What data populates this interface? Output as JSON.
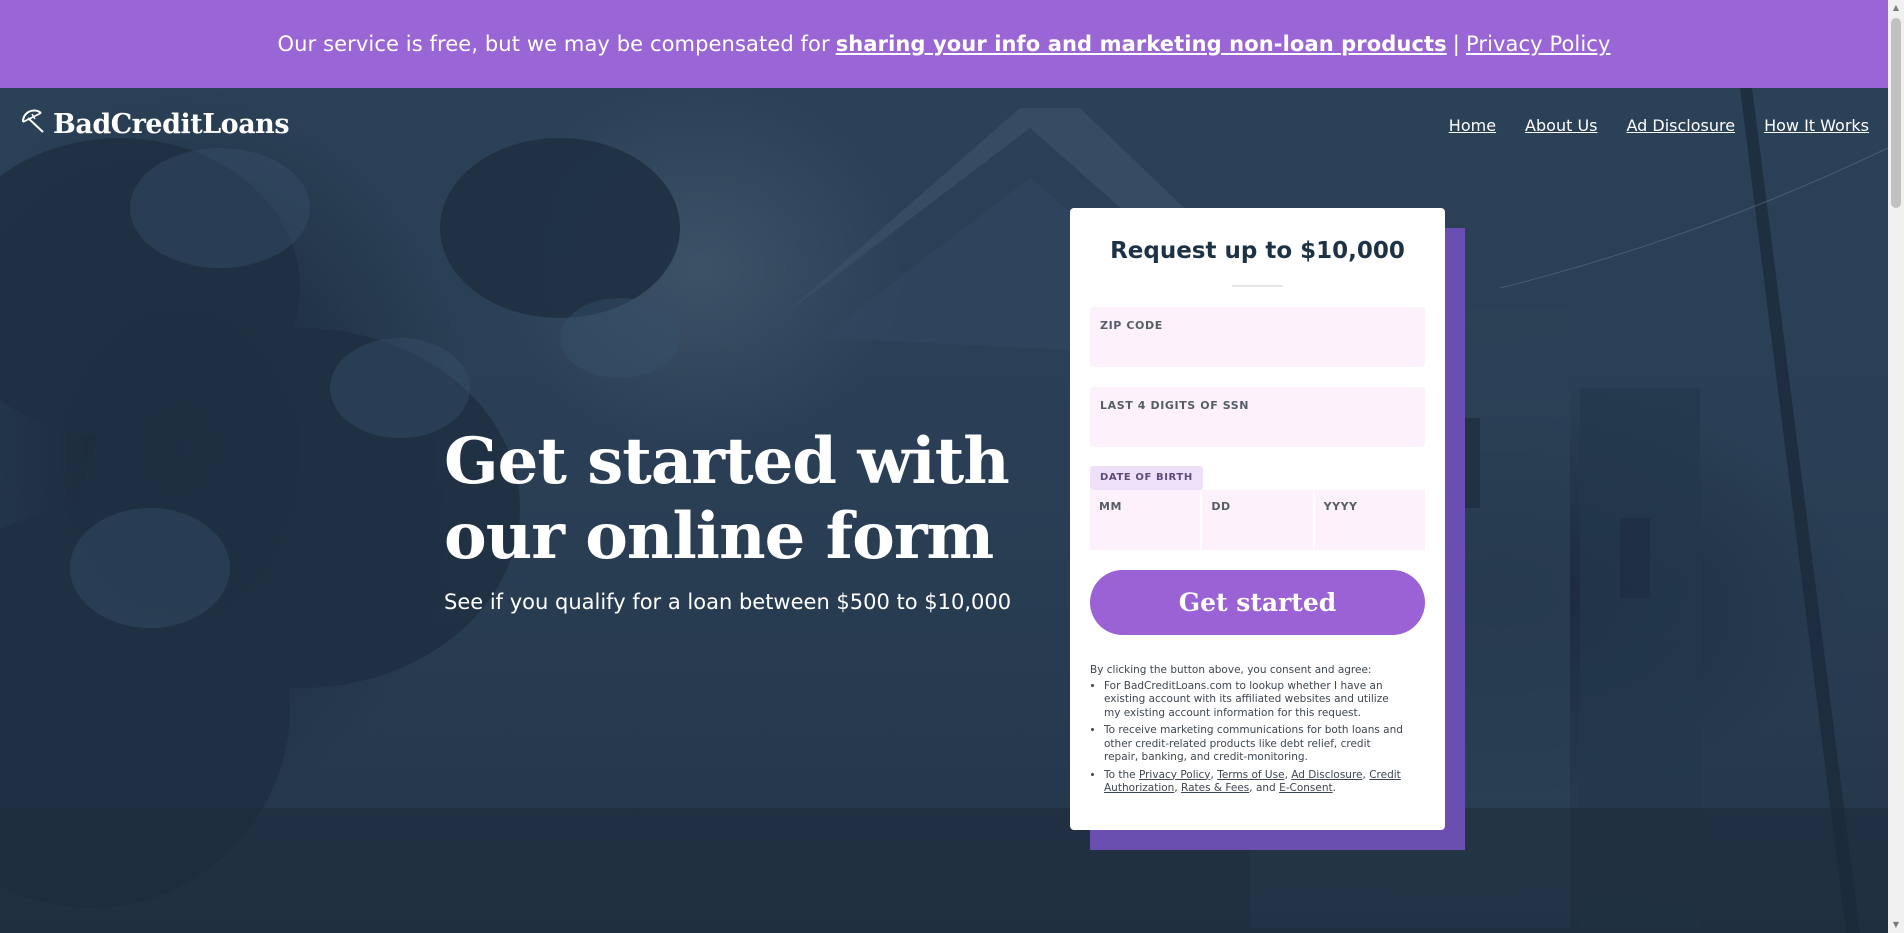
{
  "banner": {
    "text": "Our service is free, but we may be compensated for",
    "link_marketing": "sharing your info and marketing non-loan products",
    "separator": "|",
    "link_privacy": "Privacy Policy"
  },
  "header": {
    "logo_text": "BadCreditLoans",
    "nav": [
      "Home",
      "About Us",
      "Ad Disclosure",
      "How It Works"
    ]
  },
  "hero": {
    "headline": "Get started with our online form",
    "subline": "See if you qualify for a loan between $500 to $10,000"
  },
  "form": {
    "title": "Request up to $10,000",
    "zip_label": "ZIP CODE",
    "ssn_label": "LAST 4 DIGITS OF SSN",
    "dob_label": "DATE OF BIRTH",
    "dob_mm": "MM",
    "dob_dd": "DD",
    "dob_yyyy": "YYYY",
    "submit_label": "Get started",
    "consent_intro": "By clicking the button above, you consent and agree:",
    "consent_item1": "For BadCreditLoans.com to lookup whether I have an existing account with its affiliated websites and utilize my existing account information for this request.",
    "consent_item2": "To receive marketing communications for both loans and other credit-related products like debt relief, credit repair, banking, and credit-monitoring.",
    "consent_item3_prefix": "To the",
    "links": {
      "privacy": "Privacy Policy",
      "terms": "Terms of Use",
      "ad_disclosure": "Ad Disclosure",
      "credit_auth": "Credit Authorization",
      "rates": "Rates & Fees",
      "econsent": "E-Consent"
    }
  },
  "colors": {
    "banner": "#9a66d6",
    "button": "#9a62d4",
    "card_accent": "#6a4fb0",
    "hero_overlay": "#26394d"
  },
  "icons": {
    "logo": "umbrella-icon"
  }
}
